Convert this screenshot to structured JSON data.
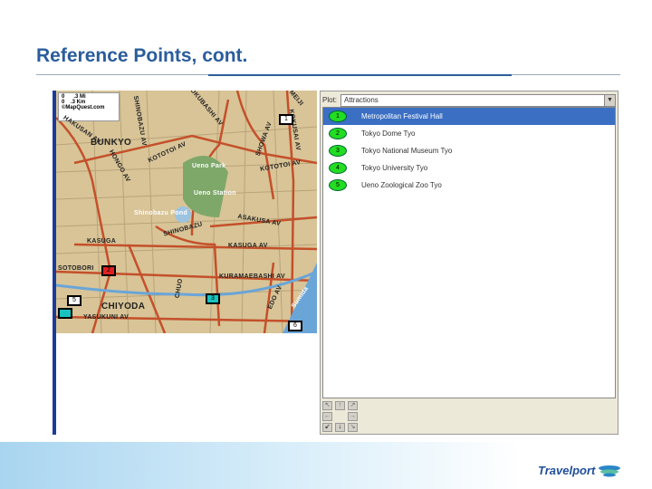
{
  "slide": {
    "title": "Reference Points, cont.",
    "logo": "Travelport"
  },
  "map": {
    "scale_mi": ".3 Mi",
    "scale_km": ".3 Km",
    "scale_zero": "0",
    "brand": "©MapQuest.com",
    "labels": [
      "BUNKYO",
      "HAKUSAN AV",
      "HONGO AV",
      "SHINOBAZU AV",
      "KOTOTOI AV",
      "OKUBASHI AV",
      "SHOWA AV",
      "KOKUSAI AV",
      "Ueno Park",
      "Ueno Station",
      "Shinobazu Pond",
      "SHINOBAZU",
      "ASAKUSA AV",
      "KASUGA AV",
      "KASUGA",
      "KURAMAEBASHI AV",
      "SOTOBORI",
      "CHIYODA",
      "YASUKUNI AV",
      "CHUO",
      "EDO AV",
      "KOTOTOI AV",
      "MEIJI",
      "Sumida"
    ],
    "markers": {
      "m1": "1",
      "m2": "2",
      "m3": "3",
      "m5": "5",
      "m6": "6"
    }
  },
  "panel": {
    "plot_label": "Plot:",
    "plot_value": "Attractions",
    "items": [
      {
        "num": "1",
        "label": "Metropolitan Festival Hall",
        "selected": true
      },
      {
        "num": "2",
        "label": "Tokyo Dome Tyo"
      },
      {
        "num": "3",
        "label": "Tokyo National Museum Tyo"
      },
      {
        "num": "4",
        "label": "Tokyo University Tyo"
      },
      {
        "num": "5",
        "label": "Ueno Zoological Zoo Tyo"
      }
    ],
    "nav": [
      "↖",
      "↑",
      "↗",
      "←",
      "",
      "→",
      "↙",
      "↓",
      "↘"
    ]
  },
  "colors": {
    "accent": "#2a5d9c",
    "selection": "#3a6fc4",
    "pin": "#22dd22"
  }
}
